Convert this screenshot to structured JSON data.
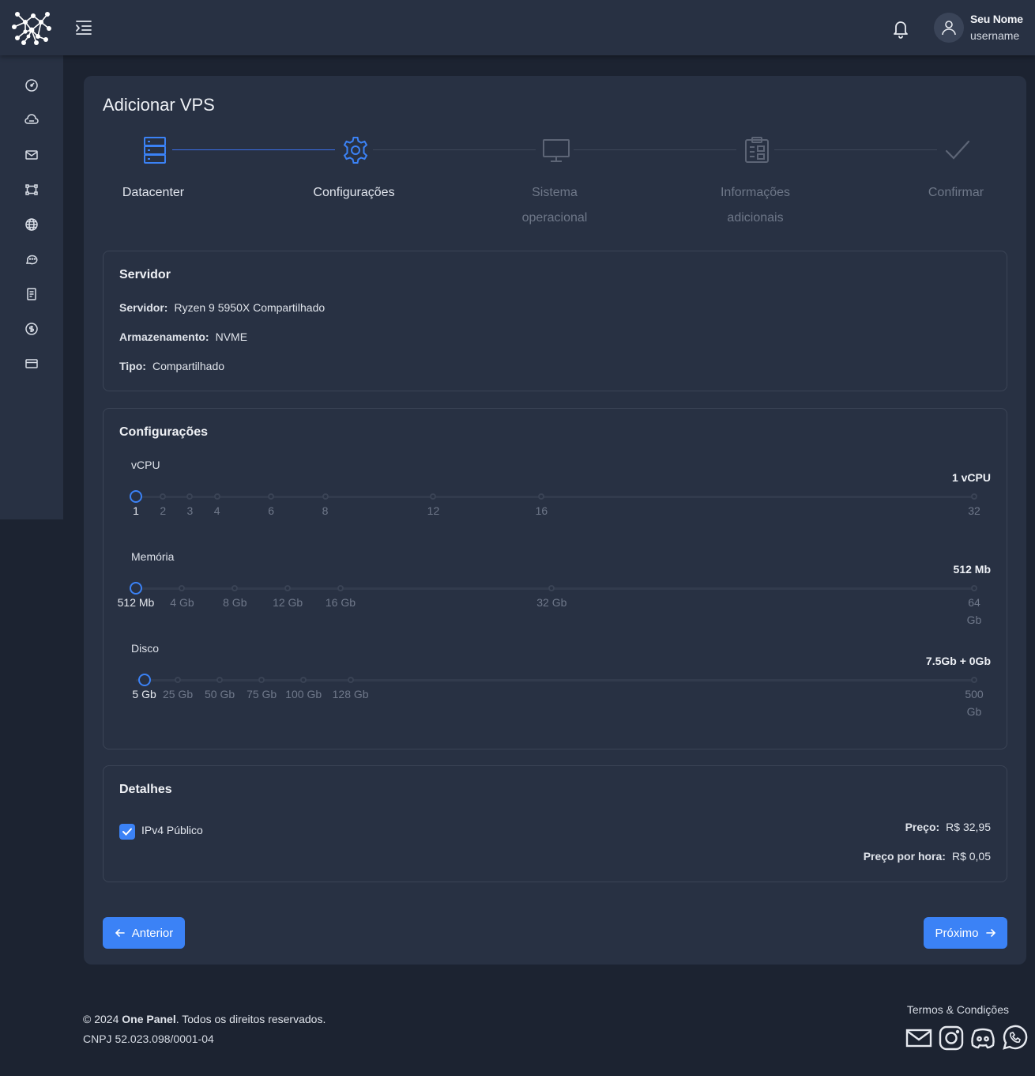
{
  "header": {
    "user_name": "Seu Nome",
    "username": "username"
  },
  "sidebar": {
    "items": [
      "dashboard-icon",
      "cloud-icon",
      "mail-icon",
      "vector-icon",
      "globe-icon",
      "chat-icon",
      "invoice-icon",
      "dollar-icon",
      "card-icon"
    ]
  },
  "page": {
    "title": "Adicionar VPS"
  },
  "stepper": {
    "steps": [
      {
        "label": "Datacenter",
        "state": "done"
      },
      {
        "label": "Configurações",
        "state": "active"
      },
      {
        "label": "Sistema operacional",
        "state": "pending"
      },
      {
        "label": "Informações adicionais",
        "state": "pending"
      },
      {
        "label": "Confirmar",
        "state": "pending"
      }
    ]
  },
  "servidor": {
    "title": "Servidor",
    "rows": [
      {
        "key": "Servidor:",
        "value": "Ryzen 9 5950X Compartilhado"
      },
      {
        "key": "Armazenamento:",
        "value": "NVME"
      },
      {
        "key": "Tipo:",
        "value": "Compartilhado"
      }
    ]
  },
  "configuracoes": {
    "title": "Configurações",
    "sliders": [
      {
        "label": "vCPU",
        "value_text": "1 vCPU",
        "min": 1,
        "max": 32,
        "value": 1,
        "marks": [
          {
            "v": 1,
            "label": "1"
          },
          {
            "v": 2,
            "label": "2"
          },
          {
            "v": 3,
            "label": "3"
          },
          {
            "v": 4,
            "label": "4"
          },
          {
            "v": 6,
            "label": "6"
          },
          {
            "v": 8,
            "label": "8"
          },
          {
            "v": 12,
            "label": "12"
          },
          {
            "v": 16,
            "label": "16"
          },
          {
            "v": 32,
            "label": "32"
          }
        ]
      },
      {
        "label": "Memória",
        "value_text": "512 Mb",
        "min": 0.5,
        "max": 64,
        "value": 0.5,
        "marks": [
          {
            "v": 0.5,
            "label": "512 Mb"
          },
          {
            "v": 4,
            "label": "4 Gb"
          },
          {
            "v": 8,
            "label": "8 Gb"
          },
          {
            "v": 12,
            "label": "12 Gb"
          },
          {
            "v": 16,
            "label": "16 Gb"
          },
          {
            "v": 32,
            "label": "32 Gb"
          },
          {
            "v": 64,
            "label": "64 Gb"
          }
        ]
      },
      {
        "label": "Disco",
        "value_text": "7.5Gb + 0Gb",
        "min": 0,
        "max": 500,
        "value": 5,
        "marks": [
          {
            "v": 5,
            "label": "5 Gb"
          },
          {
            "v": 25,
            "label": "25 Gb"
          },
          {
            "v": 50,
            "label": "50 Gb"
          },
          {
            "v": 75,
            "label": "75 Gb"
          },
          {
            "v": 100,
            "label": "100 Gb"
          },
          {
            "v": 128,
            "label": "128 Gb"
          },
          {
            "v": 500,
            "label": "500 Gb"
          }
        ]
      }
    ]
  },
  "detalhes": {
    "title": "Detalhes",
    "ipv4_label": "IPv4 Público",
    "ipv4_checked": true,
    "price_label": "Preço:",
    "price_value": "R$ 32,95",
    "hourly_label": "Preço por hora:",
    "hourly_value": "R$ 0,05"
  },
  "actions": {
    "prev_label": "Anterior",
    "next_label": "Próximo"
  },
  "footer": {
    "copy_prefix": "© 2024 ",
    "brand": "One Panel",
    "copy_suffix": ". Todos os direitos reservados.",
    "cnpj": "CNPJ 52.023.098/0001-04",
    "terms": "Termos & Condições",
    "social": [
      "mail-icon",
      "instagram-icon",
      "discord-icon",
      "whatsapp-icon"
    ]
  },
  "colors": {
    "accent": "#3b82f6",
    "background": "#1c2331",
    "surface": "#283143"
  }
}
